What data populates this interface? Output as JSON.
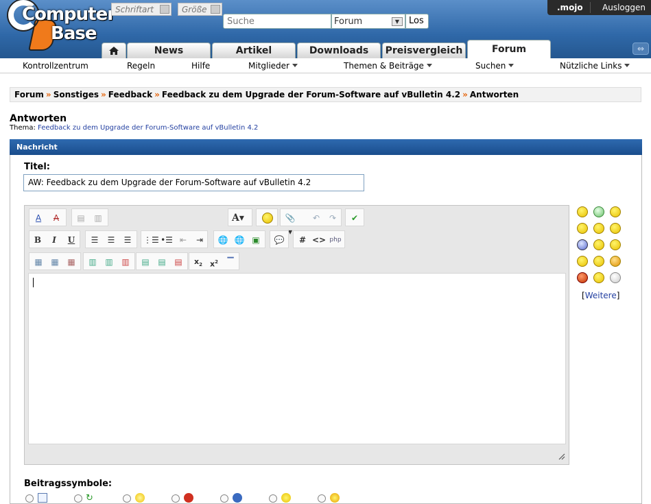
{
  "header": {
    "logo_top": "Computer",
    "logo_bottom": "Base",
    "search_placeholder": "Suche",
    "search_scope": "Forum",
    "search_button": "Los",
    "username": ".mojo",
    "logout": "Ausloggen"
  },
  "tabs": [
    "News",
    "Artikel",
    "Downloads",
    "Preisvergleich",
    "Forum"
  ],
  "subnav": [
    "Kontrollzentrum",
    "Regeln",
    "Hilfe",
    "Mitglieder",
    "Themen & Beiträge",
    "Suchen",
    "Nützliche Links"
  ],
  "breadcrumb": [
    "Forum",
    "Sonstiges",
    "Feedback",
    "Feedback zu dem Upgrade der Forum-Software auf vBulletin 4.2",
    "Antworten"
  ],
  "breadcrumb_sep": "»",
  "page": {
    "title": "Antworten",
    "thema_label": "Thema:",
    "thema_link": "Feedback zu dem Upgrade der Forum-Software auf vBulletin 4.2",
    "section": "Nachricht"
  },
  "form": {
    "title_label": "Titel:",
    "title_value": "AW: Feedback zu dem Upgrade der Forum-Software auf vBulletin 4.2",
    "font_select": "Schriftart",
    "size_select": "Größe",
    "smilies_more": "Weitere",
    "icons_label": "Beitragssymbole:"
  },
  "colors": {
    "header_blue": "#2f68a8",
    "section_bar": "#1a4d8c",
    "breadcrumb_sep": "#e5660e",
    "link": "#223fa0"
  }
}
